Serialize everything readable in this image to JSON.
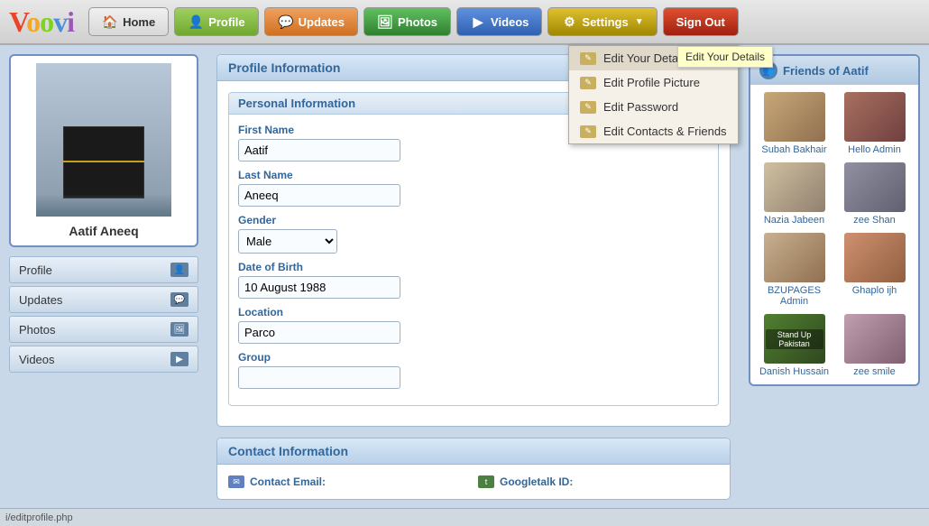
{
  "logo": {
    "letters": [
      "V",
      "o",
      "o",
      "v",
      "i"
    ]
  },
  "nav": {
    "home_label": "Home",
    "profile_label": "Profile",
    "updates_label": "Updates",
    "photos_label": "Photos",
    "videos_label": "Videos",
    "settings_label": "Settings",
    "signout_label": "Sign Out"
  },
  "settings_dropdown": {
    "items": [
      {
        "label": "Edit Your Details",
        "active": true
      },
      {
        "label": "Edit Profile Picture"
      },
      {
        "label": "Edit Password"
      },
      {
        "label": "Edit Contacts & Friends"
      }
    ],
    "tooltip": "Edit Your Details"
  },
  "sidebar": {
    "profile_name": "Aatif Aneeq",
    "menu_items": [
      {
        "label": "Profile"
      },
      {
        "label": "Updates"
      },
      {
        "label": "Photos"
      },
      {
        "label": "Videos"
      }
    ]
  },
  "profile_info": {
    "section_title": "Profile Information",
    "personal_section": "Personal Information",
    "fields": {
      "first_name_label": "First Name",
      "first_name_value": "Aatif",
      "last_name_label": "Last Name",
      "last_name_value": "Aneeq",
      "gender_label": "Gender",
      "gender_value": "Male",
      "dob_label": "Date of Birth",
      "dob_value": "10 August 1988",
      "location_label": "Location",
      "location_value": "Parco",
      "group_label": "Group",
      "group_value": ""
    }
  },
  "contact_info": {
    "section_title": "Contact Information",
    "email_label": "Contact Email:",
    "email_icon": "✉",
    "googletalk_label": "Googletalk ID:",
    "googletalk_icon": "t"
  },
  "friends": {
    "section_title": "Friends of Aatif",
    "items": [
      {
        "name": "Subah Bakhair",
        "av_class": "av1"
      },
      {
        "name": "Hello Admin",
        "av_class": "av2"
      },
      {
        "name": "Nazia Jabeen",
        "av_class": "av3"
      },
      {
        "name": "zee Shan",
        "av_class": "av4"
      },
      {
        "name": "BZUPAGES Admin",
        "av_class": "av5"
      },
      {
        "name": "Ghaplo ijh",
        "av_class": "av6"
      },
      {
        "name": "Danish Hussain",
        "av_class": "av7"
      },
      {
        "name": "zee smile",
        "av_class": "av8"
      }
    ]
  },
  "status_bar": {
    "url": "i/editprofile.php"
  },
  "page_title": "Profile"
}
